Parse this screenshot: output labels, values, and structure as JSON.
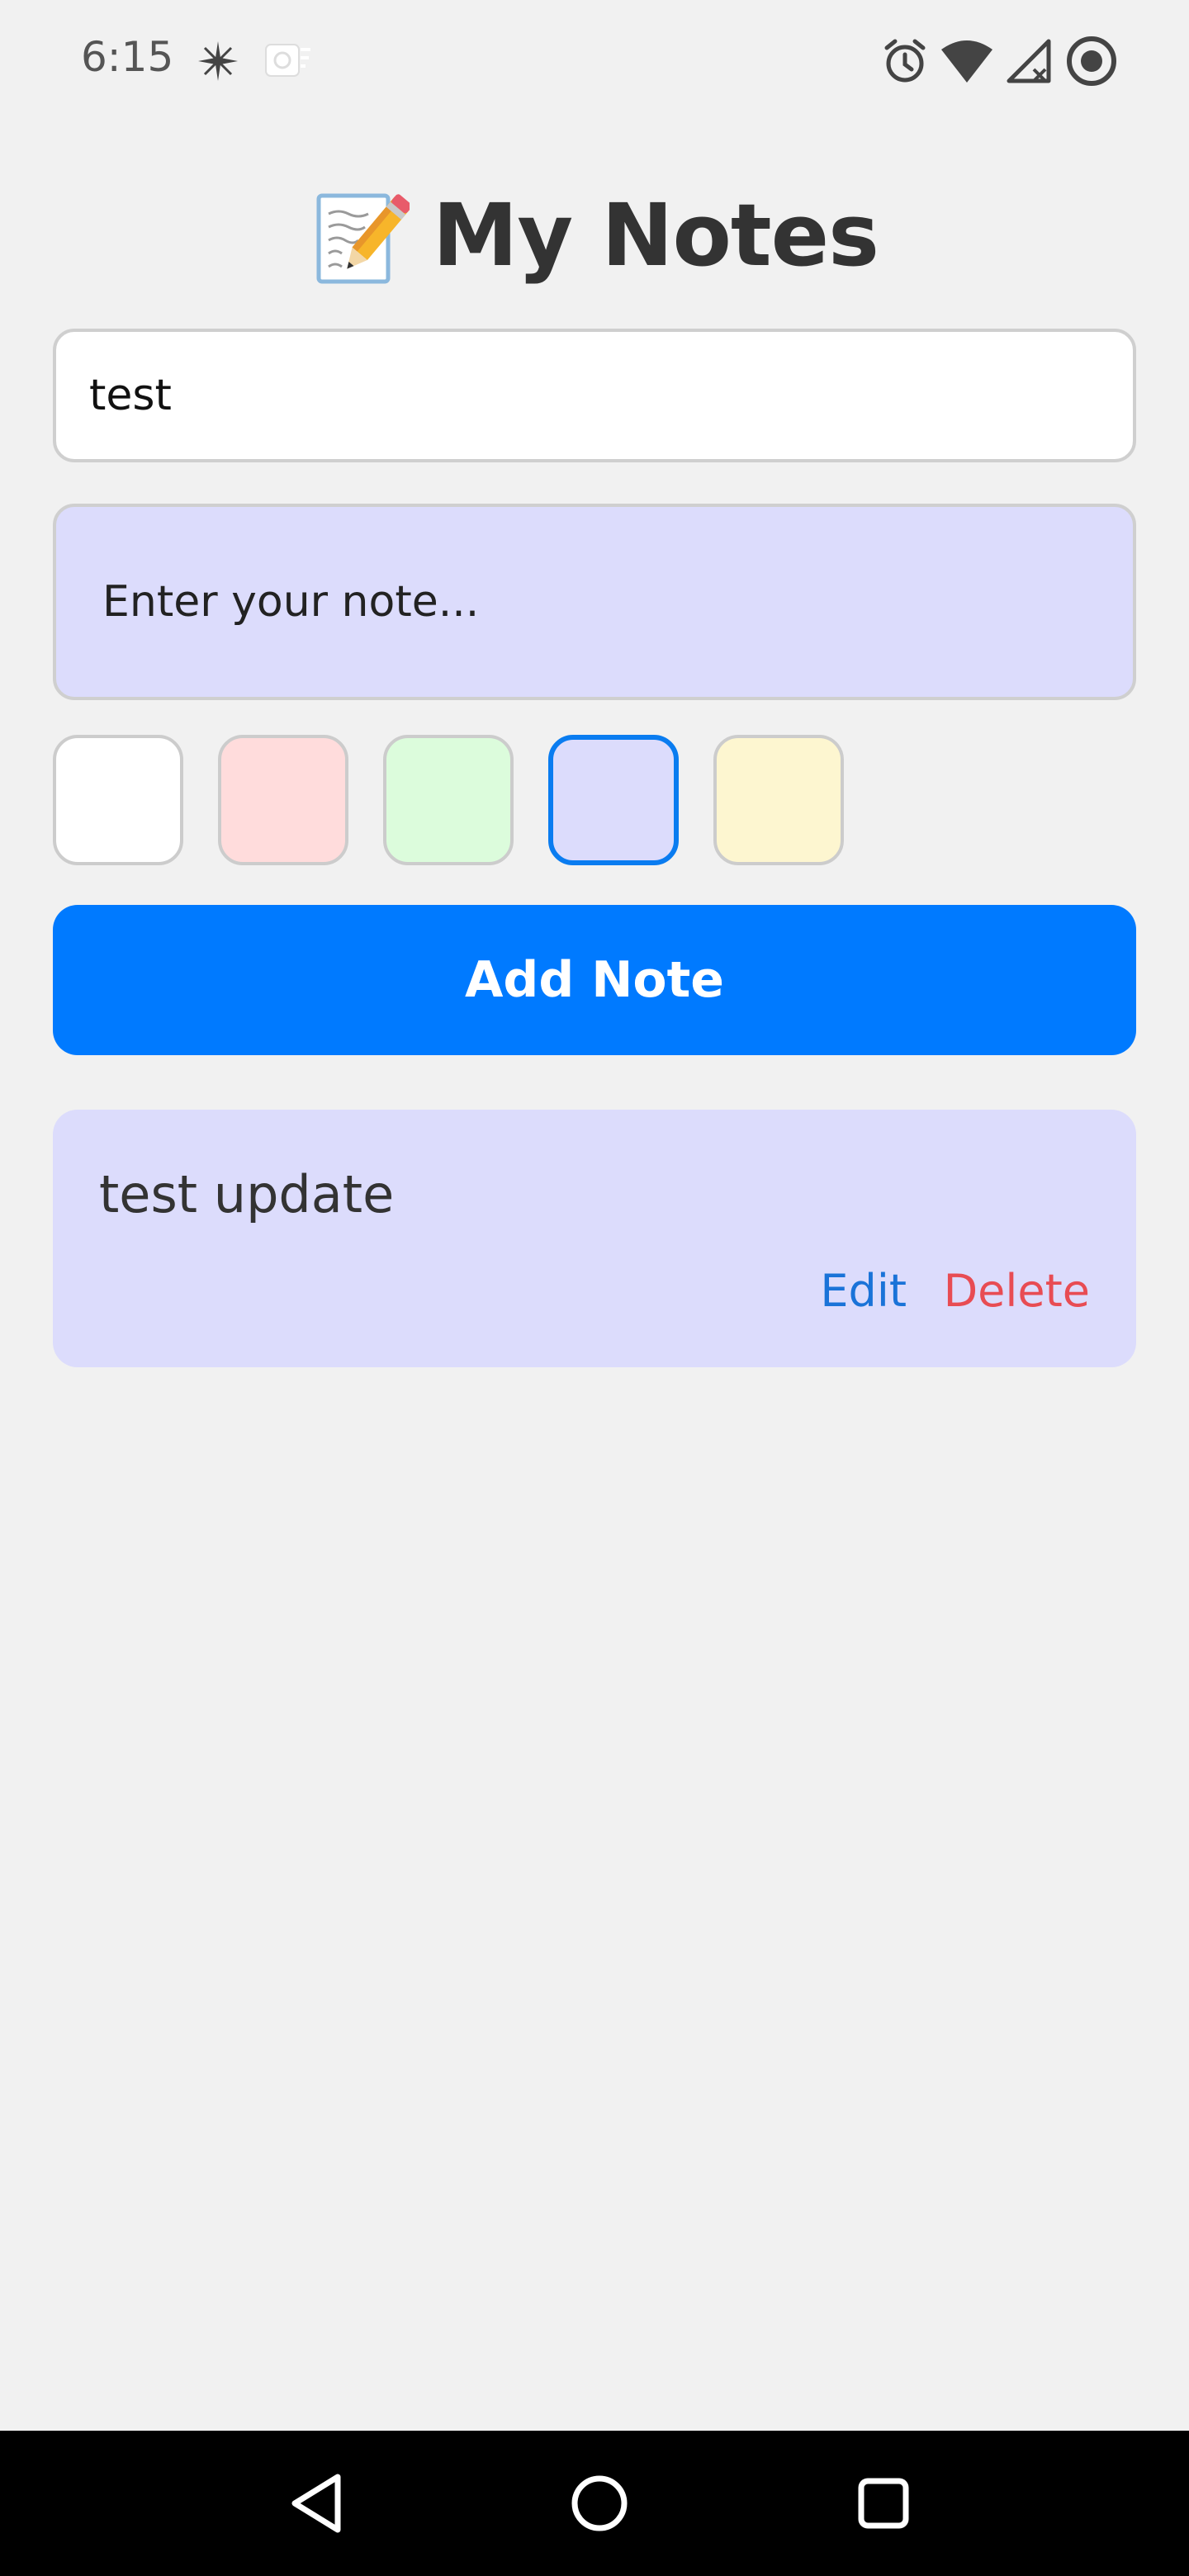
{
  "status_bar": {
    "time": "6:15",
    "left_icons": [
      "sparkle-icon",
      "notification-app-icon"
    ],
    "right_icons": [
      "alarm-icon",
      "wifi-icon",
      "signal-off-icon",
      "record-icon"
    ]
  },
  "header": {
    "emoji": "📝",
    "title": "My Notes"
  },
  "form": {
    "title_value": "test",
    "note_placeholder": "Enter your note...",
    "colors": [
      "#ffffff",
      "#ffdcdc",
      "#dcfcdc",
      "#dcdcfc",
      "#fdf6d0"
    ],
    "selected_color": "#dcdcfc",
    "add_label": "Add Note"
  },
  "notes": [
    {
      "text": "test update",
      "color": "#dcdcfc",
      "edit_label": "Edit",
      "delete_label": "Delete"
    }
  ],
  "nav": {
    "back": "back-icon",
    "home": "home-icon",
    "recents": "recents-icon"
  },
  "theme": {
    "accent": "#007aff",
    "delete_color": "#e84c53",
    "edit_color": "#1a73d8",
    "background": "#f1f1f1"
  }
}
